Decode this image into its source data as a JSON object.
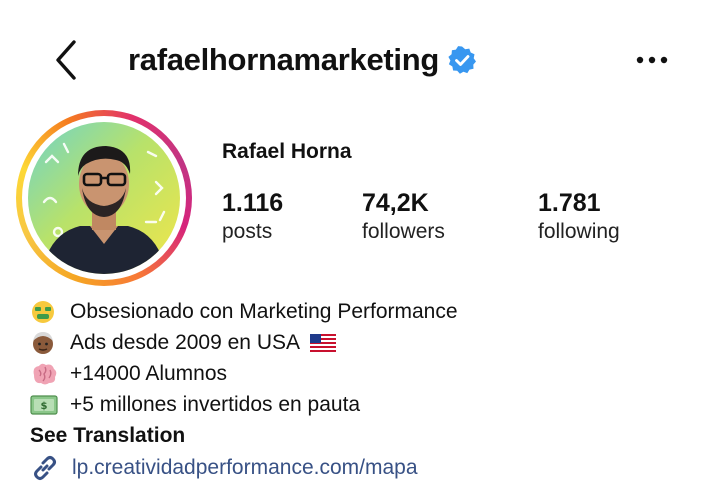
{
  "header": {
    "username": "rafaelhornamarketing",
    "back_icon": "chevron-left-icon",
    "verified_icon": "verified-badge-icon",
    "more_icon": "more-horizontal-icon",
    "verified_color": "#3897f0"
  },
  "profile": {
    "full_name": "Rafael Horna",
    "stats": {
      "posts": {
        "value": "1.116",
        "label": "posts"
      },
      "followers": {
        "value": "74,2K",
        "label": "followers"
      },
      "following": {
        "value": "1.781",
        "label": "following"
      }
    }
  },
  "bio": {
    "lines": [
      {
        "icon": "money-mouth-face-icon",
        "text": "Obsesionado con Marketing Performance"
      },
      {
        "icon": "older-person-icon",
        "text": "Ads desde 2009 en USA",
        "trailing_icon": "us-flag-icon"
      },
      {
        "icon": "brain-icon",
        "text": "+14000 Alumnos"
      },
      {
        "icon": "dollar-banknote-icon",
        "text": "+5 millones invertidos en pauta"
      }
    ],
    "see_translation": "See Translation",
    "link": {
      "icon": "link-icon",
      "text": "lp.creatividadperformance.com/mapa"
    }
  },
  "colors": {
    "link": "#385185",
    "text": "#111111"
  }
}
